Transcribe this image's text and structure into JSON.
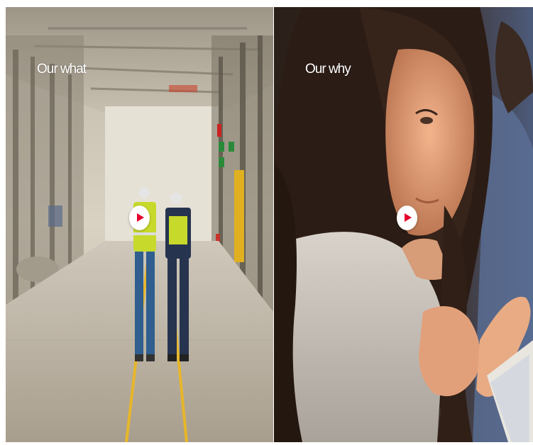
{
  "panels": [
    {
      "id": "our-what",
      "title": "Our what",
      "video_action": "play"
    },
    {
      "id": "our-why",
      "title": "Our why",
      "video_action": "play"
    }
  ],
  "colors": {
    "play_icon": "#e4002b",
    "play_button_bg": "#ffffff",
    "title_text": "#ffffff",
    "page_bg": "#ffffff"
  },
  "icons": {
    "play": "play-icon"
  }
}
